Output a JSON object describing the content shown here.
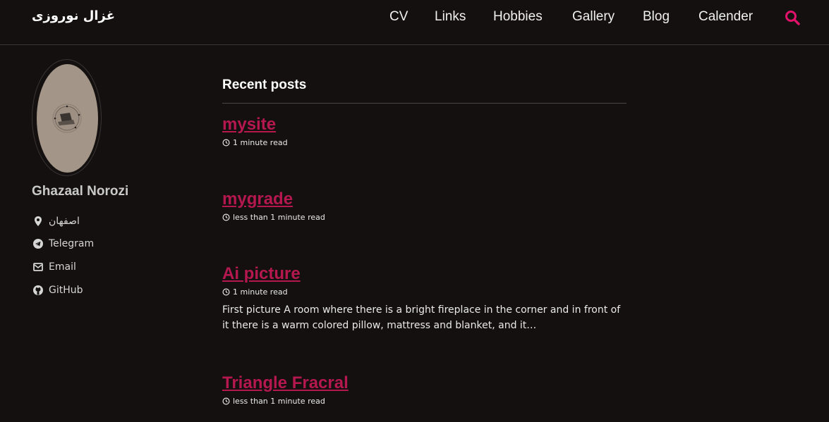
{
  "site": {
    "title": "غزال نوروزی"
  },
  "nav": {
    "items": [
      {
        "label": "CV"
      },
      {
        "label": "Links"
      },
      {
        "label": "Hobbies"
      },
      {
        "label": "Gallery"
      },
      {
        "label": "Blog"
      },
      {
        "label": "Calender"
      }
    ],
    "search_icon": "search-icon"
  },
  "author": {
    "name": "Ghazaal Norozi",
    "links": [
      {
        "label": "اصفهان",
        "icon": "map-marker-icon"
      },
      {
        "label": "Telegram",
        "icon": "telegram-icon"
      },
      {
        "label": "Email",
        "icon": "envelope-icon"
      },
      {
        "label": "GitHub",
        "icon": "github-icon"
      }
    ]
  },
  "main": {
    "section_title": "Recent posts",
    "posts": [
      {
        "title": "mysite",
        "read_time": "1 minute read",
        "excerpt": ""
      },
      {
        "title": "mygrade",
        "read_time": "less than 1 minute read",
        "excerpt": ""
      },
      {
        "title": "Ai picture",
        "read_time": "1 minute read",
        "excerpt": "First picture A room where there is a bright fireplace in the corner and in front of it there is a warm colored pillow, mattress and blanket, and it…"
      },
      {
        "title": "Triangle Fracral",
        "read_time": "less than 1 minute read",
        "excerpt": ""
      }
    ]
  },
  "colors": {
    "background": "#141010",
    "accent": "#b5174f",
    "search_accent": "#e0136a",
    "text": "#eaeaea"
  }
}
